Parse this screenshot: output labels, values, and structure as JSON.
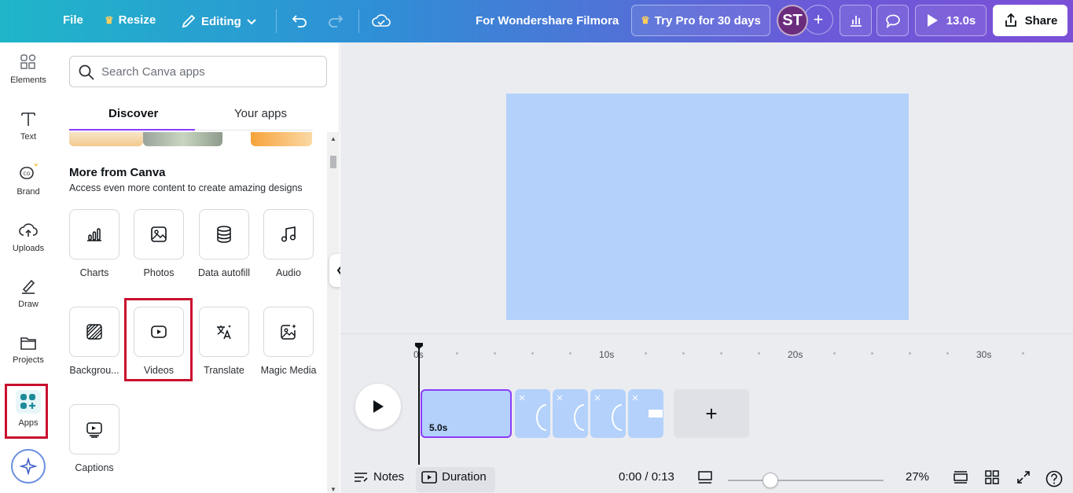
{
  "topbar": {
    "file": "File",
    "resize": "Resize",
    "editing": "Editing",
    "doc_title": "For Wondershare Filmora",
    "try_pro": "Try Pro for 30 days",
    "avatar_initials": "ST",
    "play_duration": "13.0s",
    "share": "Share"
  },
  "rail": {
    "items": [
      {
        "label": "Elements",
        "icon": "elements-icon"
      },
      {
        "label": "Text",
        "icon": "text-icon"
      },
      {
        "label": "Brand",
        "icon": "brand-icon"
      },
      {
        "label": "Uploads",
        "icon": "uploads-icon"
      },
      {
        "label": "Draw",
        "icon": "draw-icon"
      },
      {
        "label": "Projects",
        "icon": "projects-icon"
      },
      {
        "label": "Apps",
        "icon": "apps-icon"
      }
    ]
  },
  "panel": {
    "search_placeholder": "Search Canva apps",
    "tabs": [
      "Discover",
      "Your apps"
    ],
    "section_title": "More from Canva",
    "section_subtitle": "Access even more content to create amazing designs",
    "apps": [
      {
        "label": "Charts",
        "icon": "bar-chart-icon"
      },
      {
        "label": "Photos",
        "icon": "image-icon"
      },
      {
        "label": "Data autofill",
        "icon": "database-icon"
      },
      {
        "label": "Audio",
        "icon": "music-note-icon"
      },
      {
        "label": "Backgrou...",
        "icon": "background-pattern-icon"
      },
      {
        "label": "Videos",
        "icon": "video-play-icon"
      },
      {
        "label": "Translate",
        "icon": "translate-icon"
      },
      {
        "label": "Magic Media",
        "icon": "magic-media-icon"
      },
      {
        "label": "Captions",
        "icon": "captions-icon"
      }
    ]
  },
  "timeline": {
    "ticks": [
      "0s",
      "10s",
      "20s",
      "30s"
    ],
    "first_clip_duration": "5.0s",
    "notes": "Notes",
    "duration": "Duration",
    "time_readout": "0:00 / 0:13",
    "zoom": "27%",
    "zoom_fraction": 0.27
  },
  "colors": {
    "accent": "#8b3dff",
    "page_fill": "#b3d1fb",
    "highlight_box": "#c8102e"
  }
}
